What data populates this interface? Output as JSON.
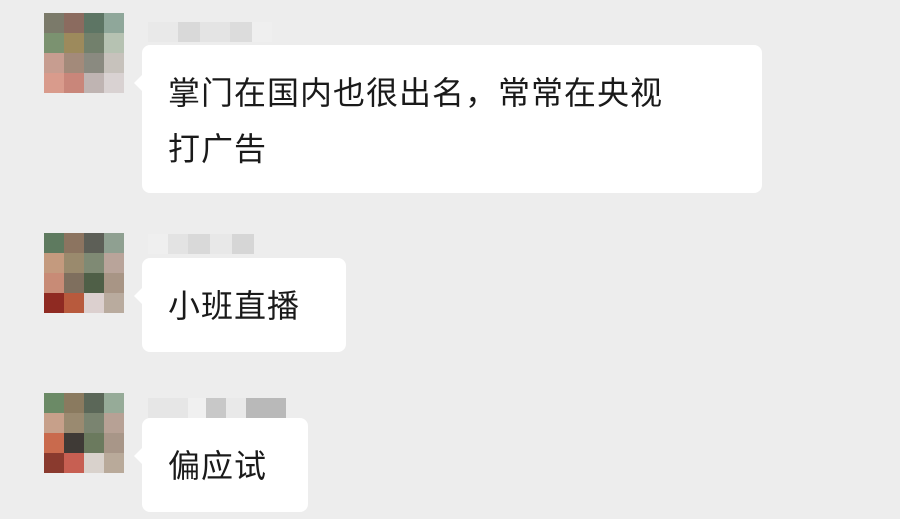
{
  "messages": [
    {
      "lines": [
        "掌门在国内也很出名，常常在央视",
        "打广告"
      ],
      "avatar_colors": [
        "#7b7a6a",
        "#8b6b5f",
        "#5d7564",
        "#8fa79a",
        "#7b9270",
        "#9d8a5c",
        "#72806c",
        "#b6c2b2",
        "#c79d90",
        "#a38a7a",
        "#8a8a80",
        "#c7c2bc",
        "#d99b8c",
        "#c9867a",
        "#bfb4b2",
        "#d9d2d2"
      ],
      "nick_blocks": [
        "#e9e9e9",
        "#d9d9d9",
        "#e4e4e4",
        "#dcdcdc",
        "#efefef"
      ]
    },
    {
      "lines": [
        "小班直播"
      ],
      "avatar_colors": [
        "#5e7a5f",
        "#8c7460",
        "#5d5f57",
        "#8fa091",
        "#c49a7e",
        "#9a8a6d",
        "#7f8a74",
        "#b9a49a",
        "#c88b76",
        "#7f6f5e",
        "#4f5f47",
        "#a89585",
        "#8f2a22",
        "#b85a3d",
        "#dcd0cf",
        "#b9ab9e"
      ],
      "nick_blocks": [
        "#efefef",
        "#e3e3e3",
        "#d9d9d9",
        "#e8e8e8",
        "#d6d6d6"
      ]
    },
    {
      "lines": [
        "偏应试"
      ],
      "avatar_colors": [
        "#6b8a66",
        "#8a7a5f",
        "#5b6758",
        "#96ab98",
        "#c7a08a",
        "#9a8a70",
        "#7a8470",
        "#b7a195",
        "#c96a4d",
        "#3f3a36",
        "#6b7a5e",
        "#a89688",
        "#8a3a2e",
        "#c75f52",
        "#d9d2cc",
        "#b9aa9a"
      ],
      "nick_blocks": [
        "#e6e6e6",
        "#f0f0f0",
        "#c8c8c8",
        "#e9e9e9",
        "#b9b9b9"
      ]
    }
  ]
}
